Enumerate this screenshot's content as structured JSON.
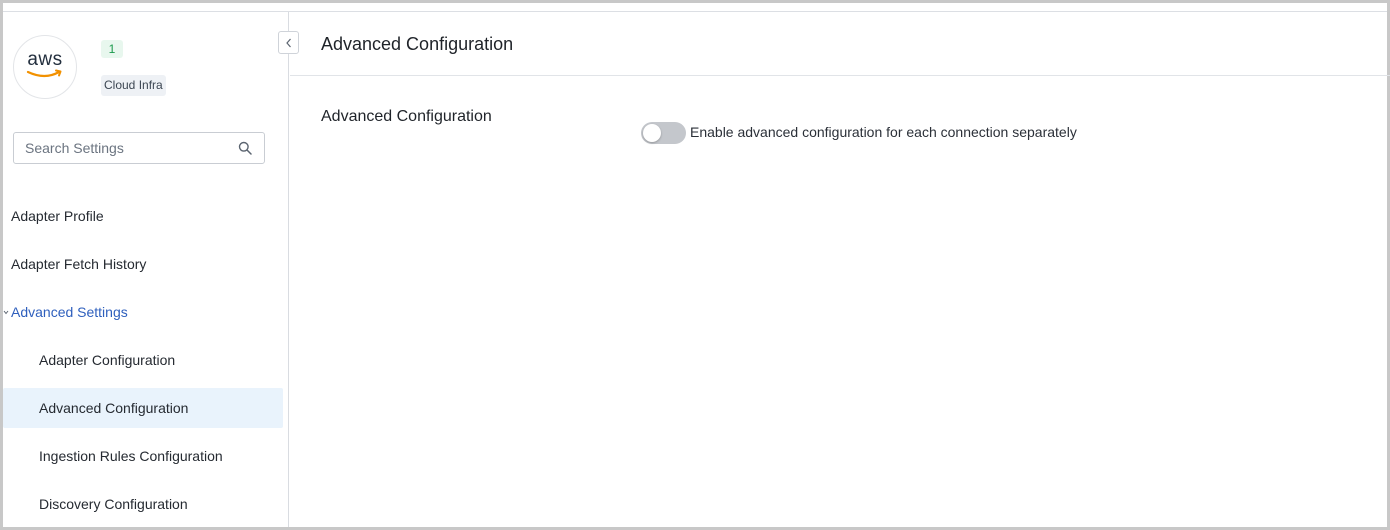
{
  "adapter": {
    "logo_text": "aws",
    "count": "1",
    "category": "Cloud Infra"
  },
  "search": {
    "placeholder": "Search Settings"
  },
  "sidebar": {
    "items": [
      {
        "label": "Adapter Profile"
      },
      {
        "label": "Adapter Fetch History"
      },
      {
        "label": "Advanced Settings"
      },
      {
        "label": "Adapter Configuration"
      },
      {
        "label": "Advanced Configuration"
      },
      {
        "label": "Ingestion Rules Configuration"
      },
      {
        "label": "Discovery Configuration"
      }
    ]
  },
  "main": {
    "title": "Advanced Configuration",
    "section_title": "Advanced Configuration",
    "toggle_label": "Enable advanced configuration for each connection separately",
    "toggle_enabled": false
  },
  "colors": {
    "accent": "#2e5fbd",
    "active_bg": "#e9f3fc",
    "badge_green": "#1a9a4c",
    "toggle_off": "#c4c7cc"
  },
  "icons": {
    "collapse": "chevron-left-icon",
    "search": "search-icon",
    "expanded_caret": "caret-down-icon"
  }
}
